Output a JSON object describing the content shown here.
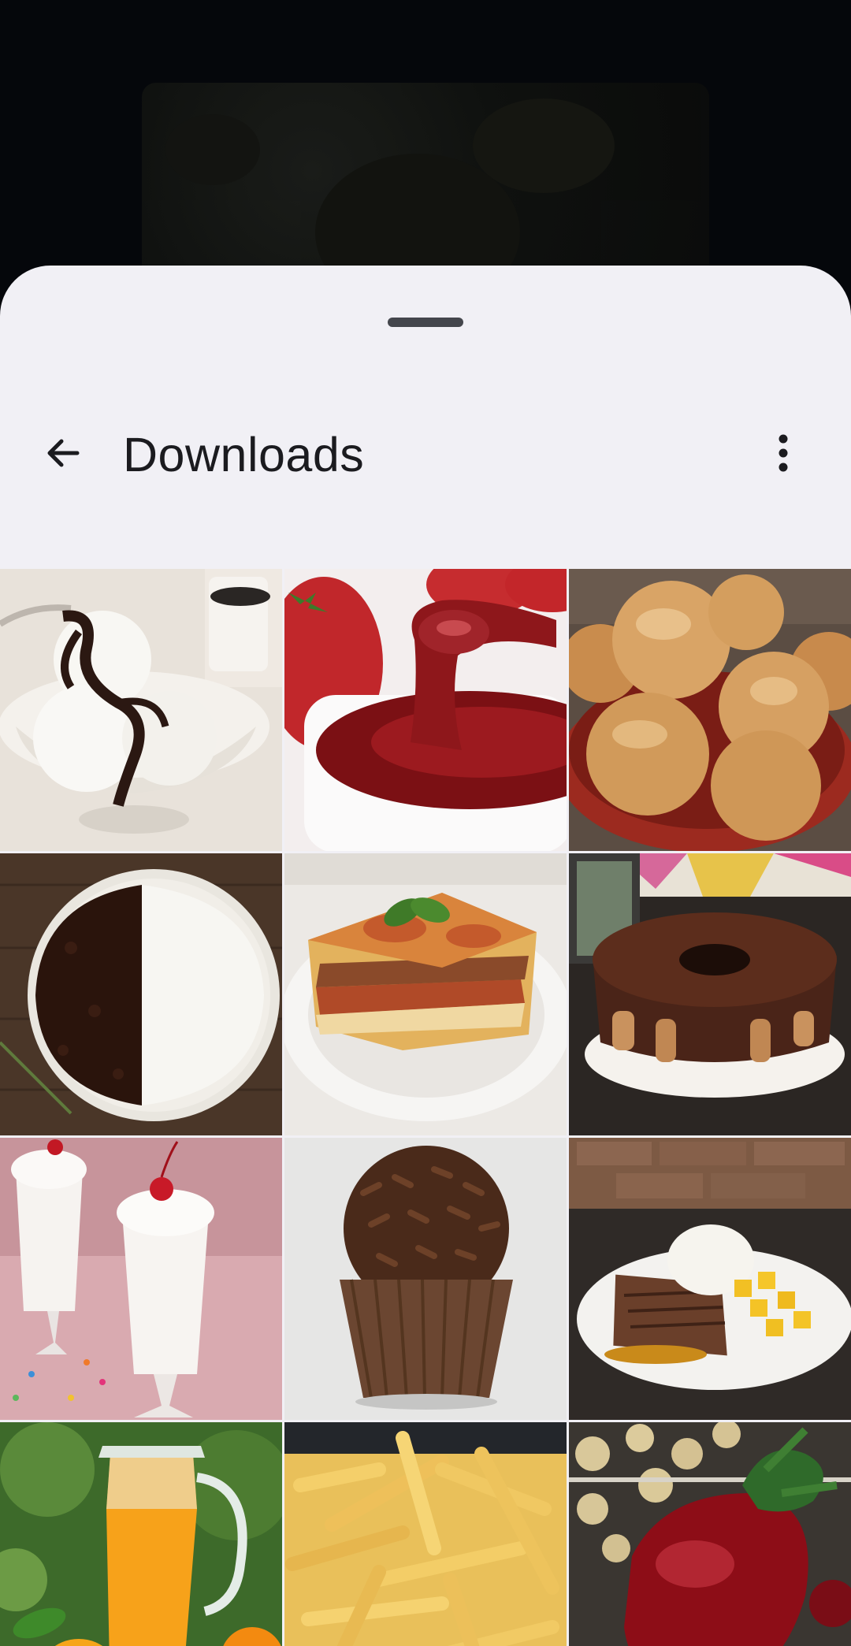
{
  "header": {
    "back_icon": "arrow-left-icon",
    "title": "Downloads",
    "menu_icon": "more-vert-icon"
  },
  "gallery": {
    "items": [
      {
        "subject": "ice-cream-with-chocolate-sauce"
      },
      {
        "subject": "strawberry-jam"
      },
      {
        "subject": "bread-rolls"
      },
      {
        "subject": "rice-and-black-beans"
      },
      {
        "subject": "lasagna"
      },
      {
        "subject": "chocolate-bundt-cake"
      },
      {
        "subject": "milkshakes"
      },
      {
        "subject": "brigadeiro"
      },
      {
        "subject": "steak-rice-corn"
      },
      {
        "subject": "orange-juice"
      },
      {
        "subject": "french-fries"
      },
      {
        "subject": "chocolate-strawberry"
      }
    ]
  },
  "colors": {
    "sheet_background": "#f1f0f5",
    "scrim": "#05070b",
    "text_primary": "#1b1b1f",
    "handle": "#44464c"
  }
}
